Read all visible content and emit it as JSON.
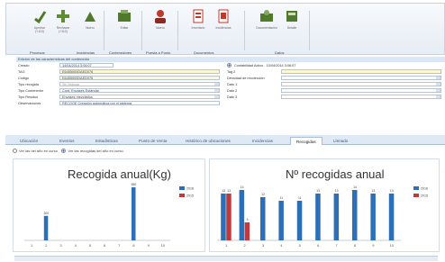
{
  "ribbon": {
    "buttons": [
      {
        "label": "Aprobar",
        "sub": "(+110)",
        "icon": "approve-icon",
        "color": "#4f7a2a"
      },
      {
        "label": "Rechazar",
        "sub": "(+110)",
        "icon": "reject-icon",
        "color": "#4f7a2a"
      },
      {
        "label": "Nuevo",
        "sub": "",
        "icon": "new-icon",
        "color": "#4f7a2a"
      },
      {
        "label": "Editar",
        "sub": "",
        "icon": "edit-icon",
        "color": "#4f7a2a"
      },
      {
        "label": "Nuevo",
        "sub": "",
        "icon": "user-icon",
        "color": "#c0392b"
      },
      {
        "label": "Inventario",
        "sub": "",
        "icon": "inventory-icon",
        "color": "#c0392b"
      },
      {
        "label": "Incidencias",
        "sub": "",
        "icon": "incidents-icon",
        "color": "#c0392b"
      },
      {
        "label": "Documentación",
        "sub": "",
        "icon": "docs-icon",
        "color": "#4f7a2a"
      },
      {
        "label": "Detalle",
        "sub": "",
        "icon": "detail-icon",
        "color": "#4f7a2a"
      }
    ],
    "groups": [
      "Procesos",
      "Incidencias",
      "Contenedores",
      "Puesta a Punto",
      "Documentos",
      "Datos"
    ]
  },
  "form": {
    "title": "Edición de las características del contenedor",
    "left_fields": [
      {
        "label": "Creado",
        "value": "14/04/2014 3:06:07"
      },
      {
        "label": "TAG",
        "value": "E6455000DAED076"
      },
      {
        "label": "Código",
        "value": "E6455000DAED076"
      },
      {
        "label": "Tipo recogida",
        "value": "Sin Asignar"
      },
      {
        "label": "Tipo Contenedor",
        "value": "Cont. Envases Estándar"
      },
      {
        "label": "Tipo Residuo",
        "value": "Envases mezclados"
      },
      {
        "label": "Observaciones",
        "value": "RECOGE Creación automática por el sistema"
      }
    ],
    "right_fields": [
      {
        "label": "",
        "value": "Contabilidad Activo - 10/04/2014 3:06:07"
      },
      {
        "label": "Tag 2",
        "value": ""
      },
      {
        "label": "Densidad de recolección",
        "value": ""
      },
      {
        "label": "Dato 1",
        "value": ""
      },
      {
        "label": "Dato 2",
        "value": ""
      },
      {
        "label": "Dato 3",
        "value": ""
      }
    ]
  },
  "tabs": [
    "Ubicación",
    "Eventos",
    "Estadísticas",
    "Punto de Venta",
    "Histórico de ubicaciones",
    "Incidencias",
    "Recogidas",
    "Llenado"
  ],
  "active_tab": "Recogidas",
  "radios": [
    "Ver las del año en curso",
    "Ver las recogidas del año en curso"
  ],
  "chart_data": [
    {
      "type": "bar",
      "title": "Recogida anual(Kg)",
      "categories": [
        "1",
        "2",
        "3",
        "4",
        "5",
        "6",
        "7",
        "8",
        "9",
        "10"
      ],
      "series": [
        {
          "name": "2016",
          "color": "#2c6fb7",
          "values": [
            0,
            300,
            0,
            0,
            0,
            0,
            0,
            650,
            0,
            0
          ]
        },
        {
          "name": "2015",
          "color": "#c0393b",
          "values": [
            0,
            0,
            0,
            0,
            0,
            0,
            0,
            0,
            0,
            0
          ]
        }
      ],
      "data_labels": [
        "",
        "300",
        "",
        "",
        "",
        "",
        "",
        "650",
        "",
        ""
      ],
      "ylim": [
        0,
        750
      ]
    },
    {
      "type": "bar",
      "title": "Nº recogidas anual",
      "categories": [
        "1",
        "2",
        "3",
        "4",
        "5",
        "6",
        "7",
        "8",
        "9",
        "10"
      ],
      "series": [
        {
          "name": "2016",
          "color": "#2c6fb7",
          "values": [
            13,
            14,
            12,
            11,
            11,
            13,
            13,
            14,
            13,
            13
          ]
        },
        {
          "name": "2015",
          "color": "#c0393b",
          "values": [
            13,
            5,
            0,
            0,
            0,
            0,
            0,
            0,
            0,
            0
          ]
        }
      ],
      "data_labels_2016": [
        "13",
        "14",
        "12",
        "11",
        "11",
        "13",
        "13",
        "14",
        "13",
        "13"
      ],
      "data_labels_2015": [
        "13",
        "5",
        "",
        "",
        "",
        "",
        "",
        "",
        "",
        ""
      ],
      "ylim": [
        0,
        17
      ]
    }
  ]
}
